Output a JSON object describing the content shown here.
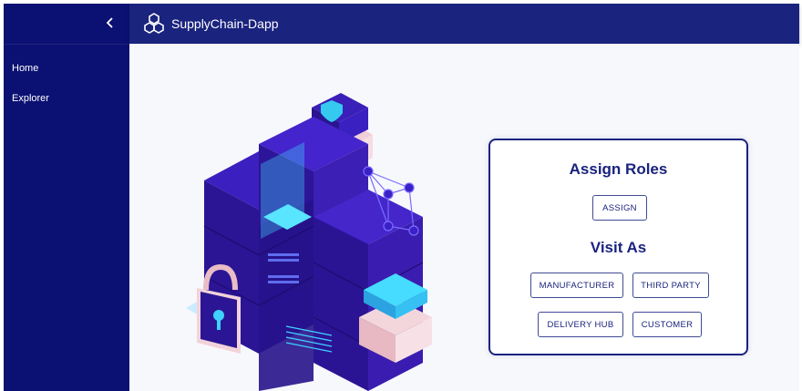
{
  "app": {
    "title": "SupplyChain-Dapp"
  },
  "sidebar": {
    "collapse_icon": "chevron-left-icon",
    "items": [
      {
        "label": "Home"
      },
      {
        "label": "Explorer"
      }
    ]
  },
  "card": {
    "assign_title": "Assign Roles",
    "assign_button": "ASSIGN",
    "visit_title": "Visit As",
    "visit_buttons": [
      {
        "label": "MANUFACTURER"
      },
      {
        "label": "THIRD PARTY"
      },
      {
        "label": "DELIVERY HUB"
      },
      {
        "label": "CUSTOMER"
      }
    ]
  },
  "colors": {
    "sidebar_bg": "#0a1172",
    "appbar_bg": "#1a237e",
    "accent": "#1a237e",
    "main_bg": "#f7f8fb"
  }
}
